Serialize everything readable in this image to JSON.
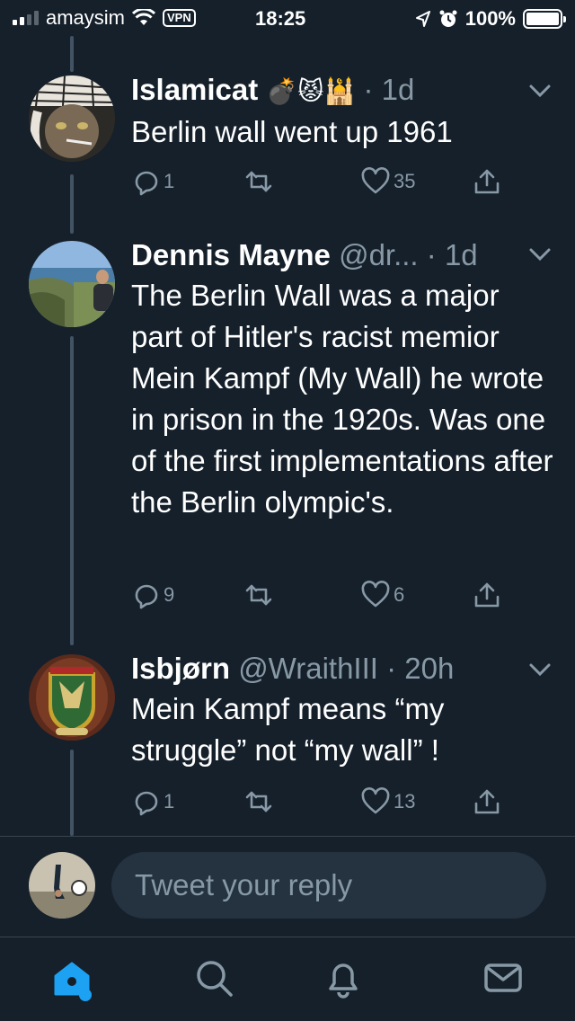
{
  "status_bar": {
    "carrier": "amaysim",
    "vpn": "VPN",
    "time": "18:25",
    "battery": "100%",
    "battery_level": 1.0
  },
  "tweets": [
    {
      "name": "Islamicat",
      "name_emojis": "💣😾🕌",
      "handle": "",
      "time": "· 1d",
      "text": "Berlin wall went up 1961",
      "replies": "1",
      "retweets": "",
      "likes": "35"
    },
    {
      "name": "Dennis Mayne",
      "name_emojis": "",
      "handle": "@dr...",
      "time": "· 1d",
      "text": "The Berlin Wall was a major part of Hitler's racist memior Mein Kampf (My Wall) he wrote in prison in the 1920s. Was one of the first implementations after the Berlin olympic's.",
      "replies": "9",
      "retweets": "",
      "likes": "6"
    },
    {
      "name": "Isbjørn",
      "name_emojis": "",
      "handle": "@WraithIII",
      "time": "· 20h",
      "text": "Mein Kampf means “my struggle” not “my wall” !",
      "replies": "1",
      "retweets": "",
      "likes": "13"
    }
  ],
  "reply_bar": {
    "placeholder": "Tweet your reply"
  },
  "colors": {
    "background": "#15202b",
    "secondary_text": "#8899a6",
    "accent": "#1da1f2",
    "input_bg": "#253341"
  },
  "icons": {
    "reply": "comment-bubble-icon",
    "retweet": "retweet-icon",
    "like": "heart-icon",
    "share": "share-icon",
    "home": "home-icon",
    "search": "search-icon",
    "notifications": "bell-icon",
    "messages": "envelope-icon"
  }
}
